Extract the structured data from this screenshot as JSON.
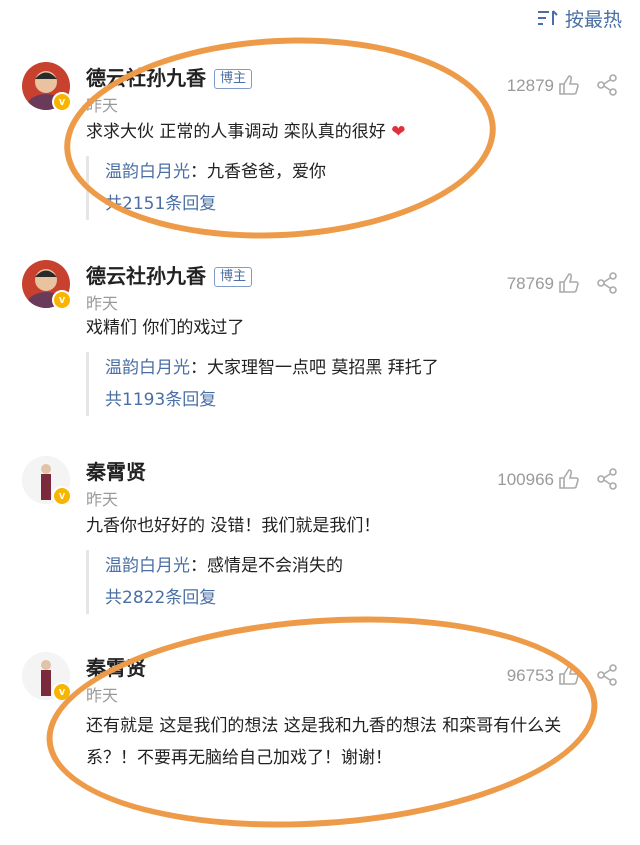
{
  "sort": {
    "label": "按最热",
    "icon": "sort-lines-icon"
  },
  "comments": [
    {
      "name": "德云社孙九香",
      "badge": "博主",
      "time": "昨天",
      "likes": "12879",
      "text": "求求大伙 正常的人事调动 栾队真的很好",
      "emoji": "❤",
      "reply_user": "温韵白月光",
      "reply_text": "九香爸爸，爱你",
      "reply_count": "共2151条回复"
    },
    {
      "name": "德云社孙九香",
      "badge": "博主",
      "time": "昨天",
      "likes": "78769",
      "text": "戏精们 你们的戏过了",
      "reply_user": "温韵白月光",
      "reply_text": "大家理智一点吧 莫招黑 拜托了",
      "reply_count": "共1193条回复"
    },
    {
      "name": "秦霄贤",
      "time": "昨天",
      "likes": "100966",
      "text": "九香你也好好的 没错！我们就是我们！",
      "reply_user": "温韵白月光",
      "reply_text": "感情是不会消失的",
      "reply_count": "共2822条回复"
    },
    {
      "name": "秦霄贤",
      "time": "昨天",
      "likes": "96753",
      "text_line1": "还有就是 这是我们的想法 这是我和九香的想法 和栾哥有什么关",
      "text_line2": "系？！不要再无脑给自己加戏了！谢谢！"
    }
  ],
  "colors": {
    "link": "#4a6fa5",
    "annotation": "#ee9b49",
    "heart": "#e0313b",
    "verified": "#f7b500"
  }
}
